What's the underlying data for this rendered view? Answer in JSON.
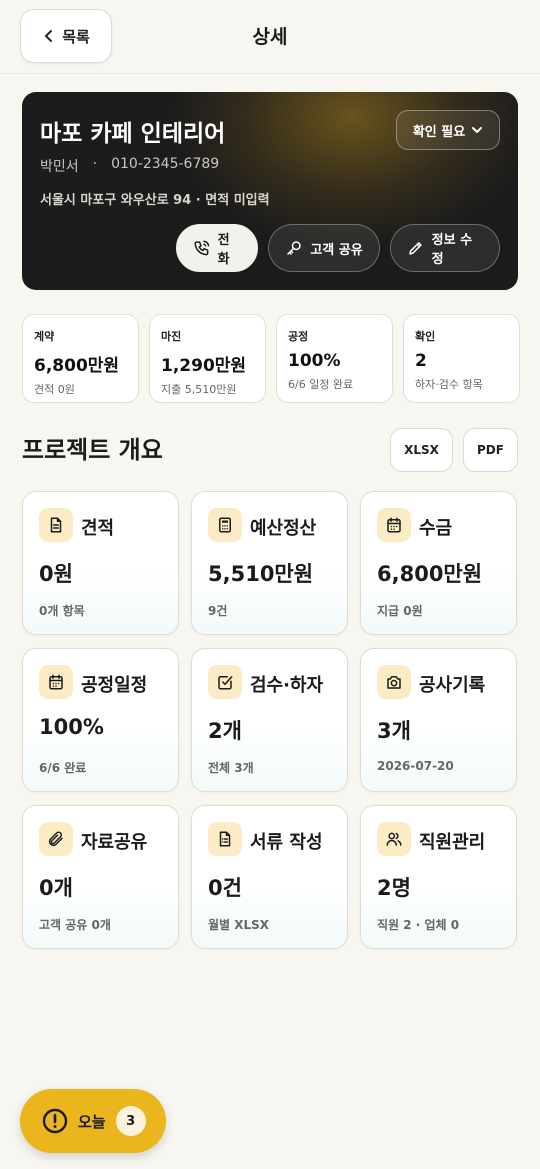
{
  "header": {
    "back_label": "목록",
    "title": "상세"
  },
  "hero": {
    "title": "마포 카페 인테리어",
    "contact_name": "박민서",
    "contact_sep": "·",
    "phone": "010-2345-6789",
    "address": "서울시 마포구 와우산로 94 · 면적 미입력",
    "status_label": "확인 필요",
    "actions": {
      "call": "전화",
      "share": "고객 공유",
      "edit": "정보 수정"
    }
  },
  "stats": [
    {
      "label": "계약",
      "value": "6,800만원",
      "sub": "견적 0원"
    },
    {
      "label": "마진",
      "value": "1,290만원",
      "sub": "지출 5,510만원"
    },
    {
      "label": "공정",
      "value": "100%",
      "sub": "6/6 일정 완료"
    },
    {
      "label": "확인",
      "value": "2",
      "sub": "하자·검수 항목"
    }
  ],
  "overview": {
    "title": "프로젝트 개요",
    "export_xlsx": "XLSX",
    "export_pdf": "PDF"
  },
  "tiles": [
    {
      "icon": "document-icon",
      "title": "견적",
      "value": "0원",
      "sub": "0개 항목"
    },
    {
      "icon": "calculator-icon",
      "title": "예산정산",
      "value": "5,510만원",
      "sub": "9건"
    },
    {
      "icon": "calendar-icon",
      "title": "수금",
      "value": "6,800만원",
      "sub": "지급 0원"
    },
    {
      "icon": "calendar-icon",
      "title": "공정일정",
      "value": "100%",
      "sub": "6/6 완료"
    },
    {
      "icon": "checkbox-icon",
      "title": "검수·하자",
      "value": "2개",
      "sub": "전체 3개"
    },
    {
      "icon": "camera-icon",
      "title": "공사기록",
      "value": "3개",
      "sub": "2026-07-20"
    },
    {
      "icon": "paperclip-icon",
      "title": "자료공유",
      "value": "0개",
      "sub": "고객 공유 0개"
    },
    {
      "icon": "file-list-icon",
      "title": "서류 작성",
      "value": "0건",
      "sub": "월별 XLSX"
    },
    {
      "icon": "users-icon",
      "title": "직원관리",
      "value": "2명",
      "sub": "직원 2 · 업체 0"
    }
  ],
  "fab": {
    "label": "오늘",
    "count": "3"
  },
  "colors": {
    "accent": "#eab51d",
    "icon_bg": "#fbecc6",
    "hero_bg": "#1c1c1c",
    "page_bg": "#f8f6f1"
  }
}
